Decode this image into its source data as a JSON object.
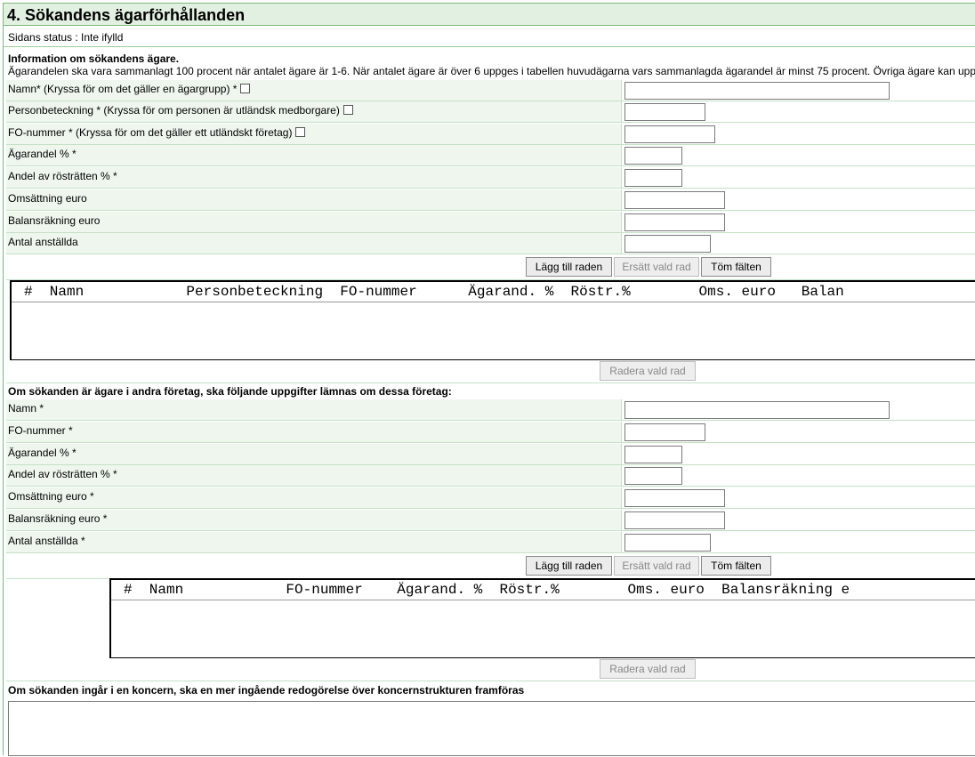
{
  "section": {
    "title": "4. Sökandens ägarförhållanden",
    "status": "Sidans status : Inte ifylld"
  },
  "owners_info": {
    "title": "Information om sökandens ägare.",
    "text": "Ägarandelen ska vara sammanlagt 100 procent när antalet ägare är 1-6. När antalet ägare är över 6 uppges i tabellen huvudägarna vars sammanlagda ägarandel är minst 75 procent. Övriga ägare kan upp"
  },
  "owner_form": {
    "name_label": "Namn* (Kryssa för om det gäller en ägargrupp) *",
    "personal_id_label": "Personbeteckning * (Kryssa för om personen är utländsk medborgare)",
    "business_id_label": "FO-nummer * (Kryssa för om det gäller ett utländskt företag)",
    "ownership_label": "Ägarandel % *",
    "voting_label": "Andel av rösträtten % *",
    "turnover_label": "Omsättning euro",
    "balance_label": "Balansräkning euro",
    "employees_label": "Antal anställda",
    "values": {
      "name": "",
      "personal_id": "",
      "business_id": "",
      "ownership": "",
      "voting": "",
      "turnover": "",
      "balance": "",
      "employees": ""
    }
  },
  "buttons": {
    "add_row": "Lägg till raden",
    "replace_row": "Ersätt vald rad",
    "clear_fields": "Töm fälten",
    "delete_row": "Radera vald rad"
  },
  "owners_table": {
    "header": "#  Namn            Personbeteckning  FO-nummer      Ägarand. %  Röstr.%        Oms. euro   Balan"
  },
  "other_companies": {
    "intro": "Om sökanden är ägare i andra företag, ska följande uppgifter lämnas om dessa företag:",
    "name_label": "Namn *",
    "business_id_label": "FO-nummer *",
    "ownership_label": "Ägarandel % *",
    "voting_label": "Andel av rösträtten % *",
    "turnover_label": "Omsättning euro *",
    "balance_label": "Balansräkning euro *",
    "employees_label": "Antal anställda *",
    "values": {
      "name": "",
      "business_id": "",
      "ownership": "",
      "voting": "",
      "turnover": "",
      "balance": "",
      "employees": ""
    }
  },
  "companies_table": {
    "header": "#  Namn            FO-nummer    Ägarand. %  Röstr.%        Oms. euro  Balansräkning e"
  },
  "group": {
    "intro": "Om sökanden ingår i en koncern, ska en mer ingående redogörelse över koncernstrukturen framföras",
    "text": ""
  }
}
